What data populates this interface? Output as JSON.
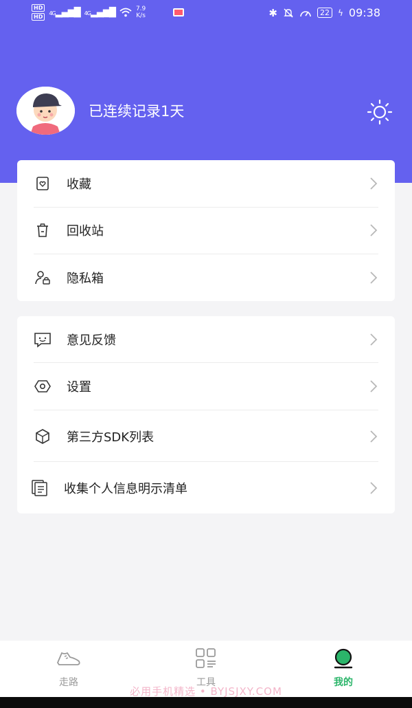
{
  "status_bar": {
    "sim1": "HD",
    "sim2": "HD",
    "network1": "4G",
    "network2": "4G",
    "speed_value": "7.9",
    "speed_unit": "K/s",
    "battery": "22",
    "time": "09:38"
  },
  "profile": {
    "greeting": "已连续记录1天"
  },
  "menu_group_1": [
    {
      "label": "收藏",
      "icon": "favorites-icon"
    },
    {
      "label": "回收站",
      "icon": "recycle-bin-icon"
    },
    {
      "label": "隐私箱",
      "icon": "privacy-box-icon"
    }
  ],
  "menu_group_2": [
    {
      "label": "意见反馈",
      "icon": "feedback-icon"
    },
    {
      "label": "设置",
      "icon": "settings-icon"
    },
    {
      "label": "第三方SDK列表",
      "icon": "sdk-list-icon"
    },
    {
      "label": "收集个人信息明示清单",
      "icon": "info-list-icon"
    }
  ],
  "bottom_nav": {
    "walk": "走路",
    "tools": "工具",
    "mine": "我的",
    "active": "我的"
  },
  "watermark": "必用手机精选 • BYJSJXY.COM",
  "colors": {
    "header": "#6461ef",
    "active_tab": "#2bb56a",
    "background": "#f4f4f6"
  }
}
